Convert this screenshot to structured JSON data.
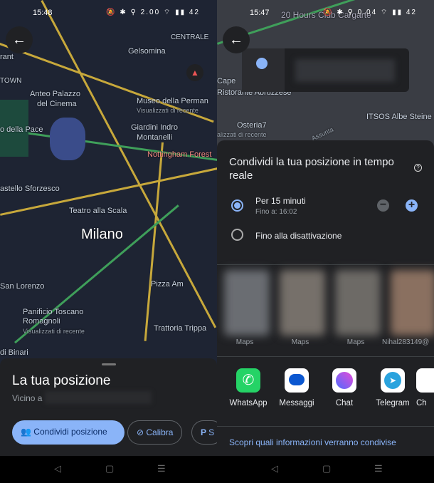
{
  "left": {
    "status": {
      "time": "15:48",
      "icons": "🔕 ✱ ⚲ 2.00 ⌔ ▮▮ 42"
    },
    "map_labels": [
      "Gelsomina",
      "CENTRALE",
      "TOWN",
      "rant",
      "Anteo Palazzo",
      "del Cinema",
      "Museo della Perman",
      "Visualizzati di recente",
      "o della Pace",
      "Giardini Indro",
      "Montanelli",
      "Nottingham Forest",
      "astello Sforzesco",
      "Teatro alla Scala",
      "Milano",
      "San Lorenzo",
      "Pizza Am",
      "Panificio Toscano",
      "Romagnoli",
      "Visualizzati di recente",
      "Trattoria Trippa",
      "di Binari"
    ],
    "sheet": {
      "title": "La tua posizione",
      "subtitle": "Vicino a"
    },
    "chips": [
      {
        "label": "Condividi posizione",
        "icon": "person-share-icon"
      },
      {
        "label": "Calibra",
        "icon": "compass-icon"
      },
      {
        "label": "S",
        "icon": "parking-icon"
      }
    ],
    "nav": {
      "back": "◁",
      "home": "▢",
      "recents": "☰"
    }
  },
  "right": {
    "status": {
      "time": "15:47",
      "icons": "🔕 ✱ ⚲ 0.04 ⌔ ▮▮ 42"
    },
    "map_labels": [
      "20 Hours Club Cargarte",
      "Cape",
      "Ristorante Abruzzese",
      "Osteria7",
      "alizzati di recente",
      "ITSOS Albe Steine",
      "Assunta"
    ],
    "sheet": {
      "title": "Condividi la tua posizione in tempo reale",
      "options": [
        {
          "label": "Per 15 minuti",
          "sub": "Fino a: 16:02",
          "selected": true
        },
        {
          "label": "Fino alla disattivazione",
          "selected": false
        }
      ],
      "contacts": [
        "Maps",
        "Maps",
        "Maps",
        "Nihal283149@"
      ],
      "apps": [
        {
          "label": "WhatsApp",
          "color": "#25d366"
        },
        {
          "label": "Messaggi",
          "color": "#ffffff"
        },
        {
          "label": "Chat",
          "color": "#ffffff"
        },
        {
          "label": "Telegram",
          "color": "#ffffff"
        },
        {
          "label": "Ch",
          "color": "#ffffff"
        }
      ],
      "footer_link": "Scopri quali informazioni verranno condivise"
    },
    "nav": {
      "back": "◁",
      "home": "▢",
      "recents": "☰"
    }
  },
  "colors": {
    "accent": "#8ab4f8",
    "sheet": "#202124"
  }
}
